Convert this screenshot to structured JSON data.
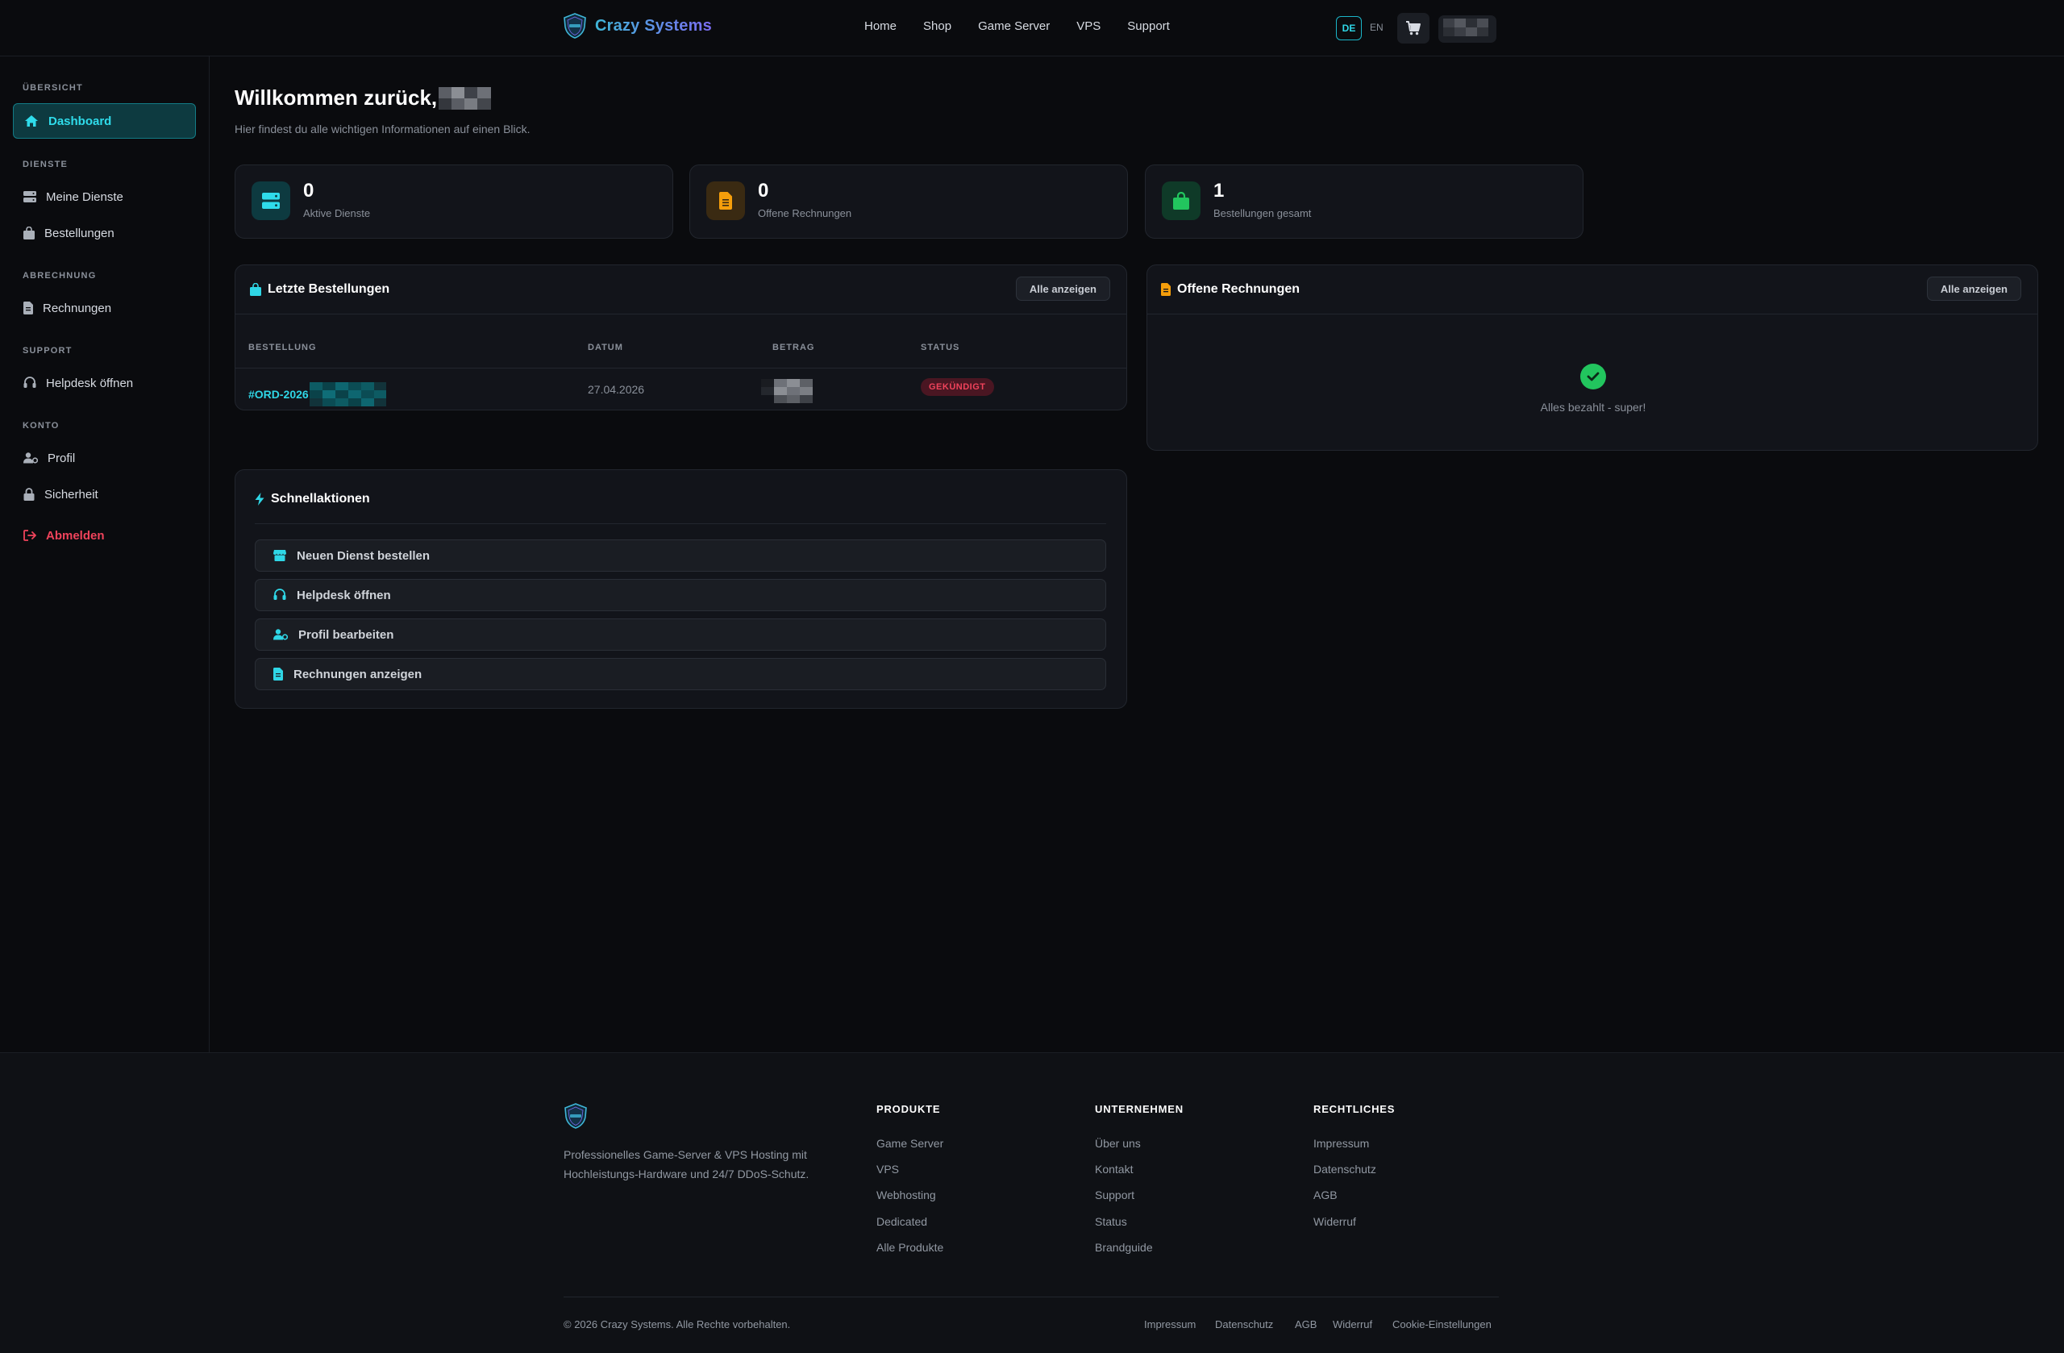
{
  "header": {
    "brand": "Crazy Systems",
    "nav": [
      "Home",
      "Shop",
      "Game Server",
      "VPS",
      "Support"
    ],
    "lang_active": "DE",
    "lang_other": "EN"
  },
  "sidebar": {
    "sections": [
      {
        "title": "ÜBERSICHT",
        "items": [
          "Dashboard"
        ]
      },
      {
        "title": "DIENSTE",
        "items": [
          "Meine Dienste",
          "Bestellungen"
        ]
      },
      {
        "title": "ABRECHNUNG",
        "items": [
          "Rechnungen"
        ]
      },
      {
        "title": "SUPPORT",
        "items": [
          "Helpdesk öffnen"
        ]
      },
      {
        "title": "KONTO",
        "items": [
          "Profil",
          "Sicherheit"
        ]
      }
    ],
    "logout": "Abmelden"
  },
  "main": {
    "title": "Willkommen zurück,",
    "subtitle": "Hier findest du alle wichtigen Informationen auf einen Blick.",
    "stats": [
      {
        "value": "0",
        "label": "Aktive Dienste"
      },
      {
        "value": "0",
        "label": "Offene Rechnungen"
      },
      {
        "value": "1",
        "label": "Bestellungen gesamt"
      }
    ],
    "orders": {
      "title": "Letzte Bestellungen",
      "view_all": "Alle anzeigen",
      "columns": [
        "BESTELLUNG",
        "DATUM",
        "BETRAG",
        "STATUS"
      ],
      "rows": [
        {
          "id": "#ORD-2026",
          "date": "27.04.2026",
          "status": "GEKÜNDIGT"
        }
      ]
    },
    "invoices": {
      "title": "Offene Rechnungen",
      "view_all": "Alle anzeigen",
      "empty": "Alles bezahlt - super!"
    },
    "quick": {
      "title": "Schnellaktionen",
      "actions": [
        "Neuen Dienst bestellen",
        "Helpdesk öffnen",
        "Profil bearbeiten",
        "Rechnungen anzeigen"
      ]
    }
  },
  "footer": {
    "description": "Professionelles Game-Server & VPS Hosting mit Hochleistungs-Hardware und 24/7 DDoS-Schutz.",
    "columns": [
      {
        "title": "PRODUKTE",
        "links": [
          "Game Server",
          "VPS",
          "Webhosting",
          "Dedicated",
          "Alle Produkte"
        ]
      },
      {
        "title": "UNTERNEHMEN",
        "links": [
          "Über uns",
          "Kontakt",
          "Support",
          "Status",
          "Brandguide"
        ]
      },
      {
        "title": "RECHTLICHES",
        "links": [
          "Impressum",
          "Datenschutz",
          "AGB",
          "Widerruf"
        ]
      }
    ],
    "copyright": "© 2026 Crazy Systems. Alle Rechte vorbehalten.",
    "bottom_links": [
      "Impressum",
      "Datenschutz",
      "AGB",
      "Widerruf",
      "Cookie-Einstellungen"
    ]
  },
  "colors": {
    "accent": "#2fd6e6",
    "danger": "#f0435b",
    "success": "#22c55e",
    "warning": "#f59e0b",
    "background": "#0a0b0e",
    "card": "#12141a"
  }
}
